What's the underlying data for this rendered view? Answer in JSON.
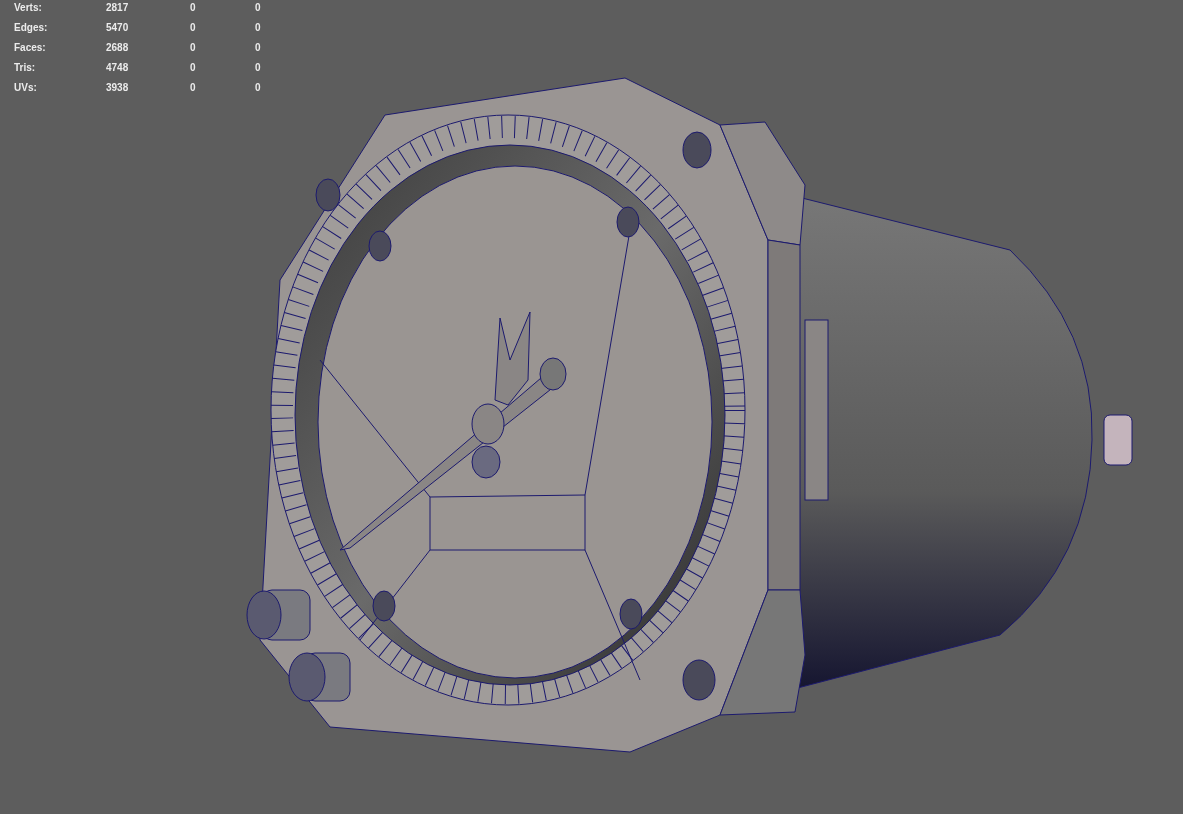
{
  "hud": {
    "rows": [
      {
        "label": "Verts:",
        "values": [
          "2817",
          "0",
          "0"
        ]
      },
      {
        "label": "Edges:",
        "values": [
          "5470",
          "0",
          "0"
        ]
      },
      {
        "label": "Faces:",
        "values": [
          "2688",
          "0",
          "0"
        ]
      },
      {
        "label": "Tris:",
        "values": [
          "4748",
          "0",
          "0"
        ]
      },
      {
        "label": "UVs:",
        "values": [
          "3938",
          "0",
          "0"
        ]
      }
    ]
  }
}
